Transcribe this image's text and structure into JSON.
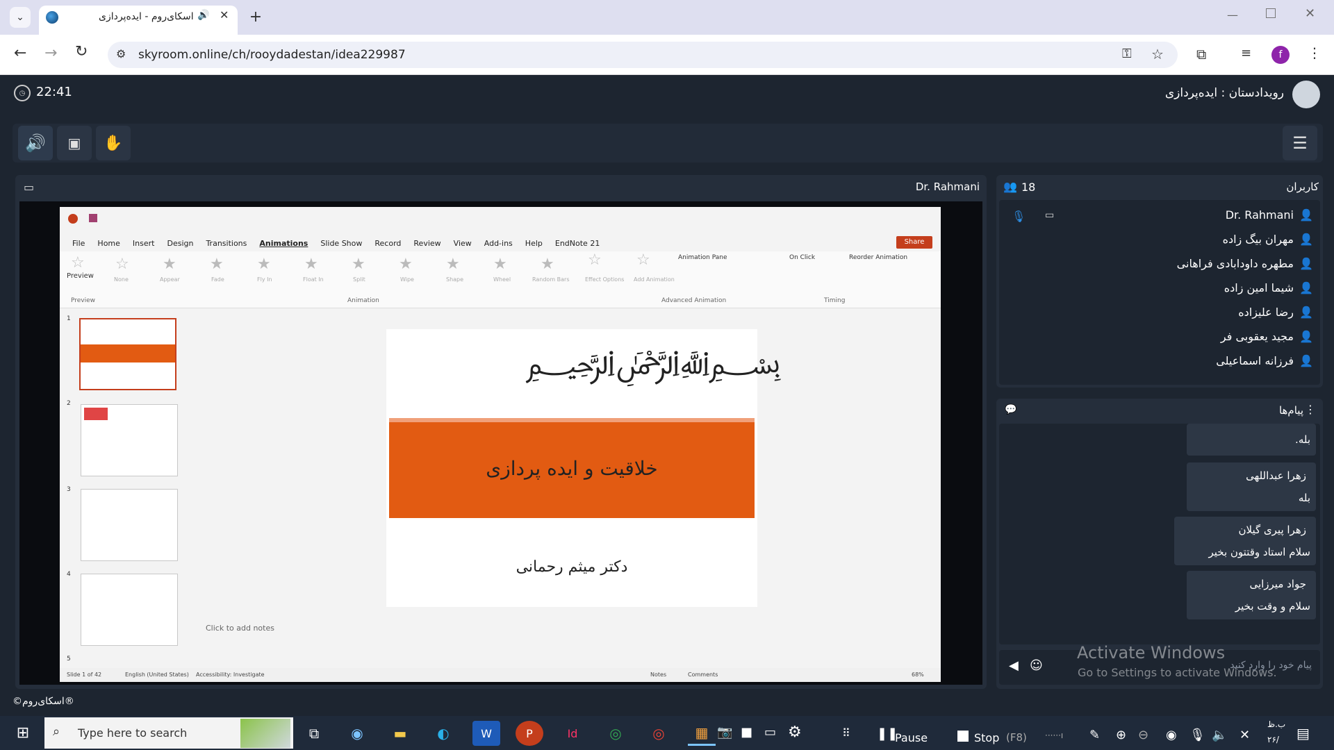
{
  "browser": {
    "tab_title": "اسکای‌روم - ایده‌پردازی",
    "url": "skyroom.online/ch/rooydadestan/idea229987",
    "new_tab_icon": "plus-icon",
    "profile_initial": "f"
  },
  "app": {
    "clock": "22:41",
    "room_title": "رویدادستان : ایده‌پردازی",
    "presenter": "Dr. Rahmani",
    "footer": "©اسکای‌روم®"
  },
  "users_panel": {
    "title": "کاربران",
    "count": "18",
    "users": [
      "Dr. Rahmani",
      "مهران بیگ زاده",
      "مطهره داودابادی فراهانی",
      "شیما امین زاده",
      "رضا علیزاده",
      "مجید یعقوبی فر",
      "فرزانه اسماعیلی"
    ]
  },
  "messages_panel": {
    "title": "پیام‌ها",
    "messages": [
      {
        "name": "",
        "text": "بله."
      },
      {
        "name": "زهرا عبداللهی",
        "text": "بله"
      },
      {
        "name": "زهرا پیری گیلان",
        "text": "سلام استاد وقتتون بخیر"
      },
      {
        "name": "جواد میرزایی",
        "text": "سلام و وقت بخیر"
      }
    ],
    "input_placeholder": "پیام خود را وارد کنید"
  },
  "watermark": {
    "line1": "Activate Windows",
    "line2": "Go to Settings to activate Windows."
  },
  "powerpoint": {
    "menu": [
      "File",
      "Home",
      "Insert",
      "Design",
      "Transitions",
      "Animations",
      "Slide Show",
      "Record",
      "Review",
      "View",
      "Add-ins",
      "Help",
      "EndNote 21"
    ],
    "active_menu": "Animations",
    "share": "Share",
    "preview": "Preview",
    "group_preview": "Preview",
    "group_animation": "Animation",
    "group_advanced": "Advanced Animation",
    "group_timing": "Timing",
    "animation_pane": "Animation Pane",
    "on_click": "On Click",
    "reorder": "Reorder Animation",
    "effects": [
      "None",
      "Appear",
      "Fade",
      "Fly In",
      "Float In",
      "Split",
      "Wipe",
      "Shape",
      "Wheel",
      "Random Bars",
      "Effect Options",
      "Add Animation"
    ],
    "slide_title": "خلاقیت و ایده پردازی",
    "slide_author": "دکتر میثم رحمانی",
    "notes_placeholder": "Click to add notes",
    "status_slide": "Slide 1 of 42",
    "status_lang": "English (United States)",
    "status_access": "Accessibility: Investigate",
    "status_notes": "Notes",
    "status_comments": "Comments",
    "zoom": "68%",
    "thumb_numbers": [
      "1",
      "2",
      "3",
      "4",
      "5"
    ]
  },
  "taskbar": {
    "search_placeholder": "Type here to search",
    "pause": "Pause",
    "stop": "Stop",
    "stop_key": "(F8)",
    "time": "ب.ظ",
    "date": "۲۶/"
  },
  "colors": {
    "accent": "#1e88e5",
    "orange": "#e25b12",
    "dark": "#1d2530"
  }
}
